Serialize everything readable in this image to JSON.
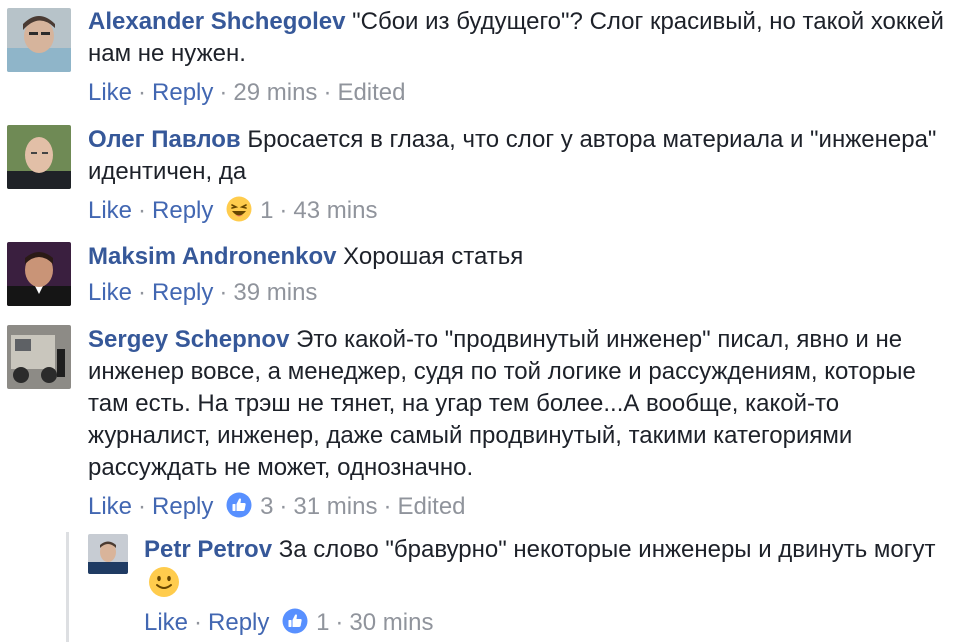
{
  "comments": [
    {
      "author": "Alexander Shchegolev",
      "text": "\"Сбои из будущего\"? Слог красивый, но такой хоккей нам не нужен.",
      "like": "Like",
      "reply": "Reply",
      "time": "29 mins",
      "edited": "Edited"
    },
    {
      "author": "Олег Павлов",
      "text": "Бросается в глаза, что слог у автора материала и \"инженера\" идентичен, да",
      "like": "Like",
      "reply": "Reply",
      "reaction_icon": "laughing-face-icon",
      "reaction_count": "1",
      "time": "43 mins"
    },
    {
      "author": "Maksim Andronenkov",
      "text": "Хорошая статья",
      "like": "Like",
      "reply": "Reply",
      "time": "39 mins"
    },
    {
      "author": "Sergey Schepnov",
      "text": "Это какой-то \"продвинутый инженер\" писал, явно и не инженер вовсе, а менеджер, судя по той логике и рассуждениям, которые там есть. На трэш не тянет, на угар тем более...А вообще, какой-то журналист, инженер, даже самый продвинутый, такими категориями рассуждать не может, однозначно.",
      "like": "Like",
      "reply": "Reply",
      "reaction_icon": "thumbs-up-icon",
      "reaction_count": "3",
      "time": "31 mins",
      "edited": "Edited"
    }
  ],
  "reply": {
    "author": "Petr Petrov",
    "text": "За слово \"бравурно\" некоторые инженеры и двинуть могут",
    "emoji": "slightly-smiling-face-icon",
    "like": "Like",
    "reply": "Reply",
    "reaction_icon": "thumbs-up-icon",
    "reaction_count": "1",
    "time": "30 mins"
  },
  "colors": {
    "author": "#365899",
    "action_link": "#4267b2",
    "meta": "#90949c",
    "text": "#1d2129",
    "like_blue": "#5890ff",
    "emoji_yellow": "#ffcc4d"
  }
}
